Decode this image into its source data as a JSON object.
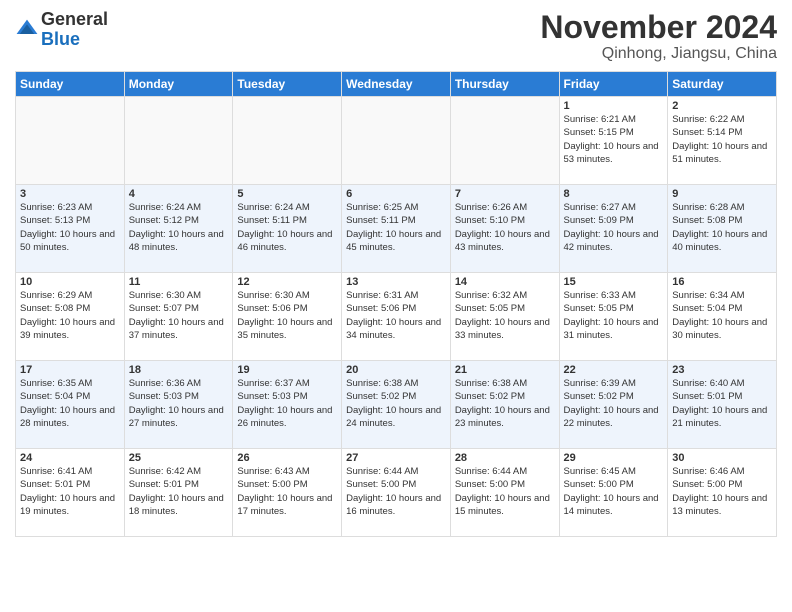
{
  "header": {
    "logo_general": "General",
    "logo_blue": "Blue",
    "month_title": "November 2024",
    "location": "Qinhong, Jiangsu, China"
  },
  "calendar": {
    "days_of_week": [
      "Sunday",
      "Monday",
      "Tuesday",
      "Wednesday",
      "Thursday",
      "Friday",
      "Saturday"
    ],
    "weeks": [
      [
        {
          "day": "",
          "info": ""
        },
        {
          "day": "",
          "info": ""
        },
        {
          "day": "",
          "info": ""
        },
        {
          "day": "",
          "info": ""
        },
        {
          "day": "",
          "info": ""
        },
        {
          "day": "1",
          "info": "Sunrise: 6:21 AM\nSunset: 5:15 PM\nDaylight: 10 hours and 53 minutes."
        },
        {
          "day": "2",
          "info": "Sunrise: 6:22 AM\nSunset: 5:14 PM\nDaylight: 10 hours and 51 minutes."
        }
      ],
      [
        {
          "day": "3",
          "info": "Sunrise: 6:23 AM\nSunset: 5:13 PM\nDaylight: 10 hours and 50 minutes."
        },
        {
          "day": "4",
          "info": "Sunrise: 6:24 AM\nSunset: 5:12 PM\nDaylight: 10 hours and 48 minutes."
        },
        {
          "day": "5",
          "info": "Sunrise: 6:24 AM\nSunset: 5:11 PM\nDaylight: 10 hours and 46 minutes."
        },
        {
          "day": "6",
          "info": "Sunrise: 6:25 AM\nSunset: 5:11 PM\nDaylight: 10 hours and 45 minutes."
        },
        {
          "day": "7",
          "info": "Sunrise: 6:26 AM\nSunset: 5:10 PM\nDaylight: 10 hours and 43 minutes."
        },
        {
          "day": "8",
          "info": "Sunrise: 6:27 AM\nSunset: 5:09 PM\nDaylight: 10 hours and 42 minutes."
        },
        {
          "day": "9",
          "info": "Sunrise: 6:28 AM\nSunset: 5:08 PM\nDaylight: 10 hours and 40 minutes."
        }
      ],
      [
        {
          "day": "10",
          "info": "Sunrise: 6:29 AM\nSunset: 5:08 PM\nDaylight: 10 hours and 39 minutes."
        },
        {
          "day": "11",
          "info": "Sunrise: 6:30 AM\nSunset: 5:07 PM\nDaylight: 10 hours and 37 minutes."
        },
        {
          "day": "12",
          "info": "Sunrise: 6:30 AM\nSunset: 5:06 PM\nDaylight: 10 hours and 35 minutes."
        },
        {
          "day": "13",
          "info": "Sunrise: 6:31 AM\nSunset: 5:06 PM\nDaylight: 10 hours and 34 minutes."
        },
        {
          "day": "14",
          "info": "Sunrise: 6:32 AM\nSunset: 5:05 PM\nDaylight: 10 hours and 33 minutes."
        },
        {
          "day": "15",
          "info": "Sunrise: 6:33 AM\nSunset: 5:05 PM\nDaylight: 10 hours and 31 minutes."
        },
        {
          "day": "16",
          "info": "Sunrise: 6:34 AM\nSunset: 5:04 PM\nDaylight: 10 hours and 30 minutes."
        }
      ],
      [
        {
          "day": "17",
          "info": "Sunrise: 6:35 AM\nSunset: 5:04 PM\nDaylight: 10 hours and 28 minutes."
        },
        {
          "day": "18",
          "info": "Sunrise: 6:36 AM\nSunset: 5:03 PM\nDaylight: 10 hours and 27 minutes."
        },
        {
          "day": "19",
          "info": "Sunrise: 6:37 AM\nSunset: 5:03 PM\nDaylight: 10 hours and 26 minutes."
        },
        {
          "day": "20",
          "info": "Sunrise: 6:38 AM\nSunset: 5:02 PM\nDaylight: 10 hours and 24 minutes."
        },
        {
          "day": "21",
          "info": "Sunrise: 6:38 AM\nSunset: 5:02 PM\nDaylight: 10 hours and 23 minutes."
        },
        {
          "day": "22",
          "info": "Sunrise: 6:39 AM\nSunset: 5:02 PM\nDaylight: 10 hours and 22 minutes."
        },
        {
          "day": "23",
          "info": "Sunrise: 6:40 AM\nSunset: 5:01 PM\nDaylight: 10 hours and 21 minutes."
        }
      ],
      [
        {
          "day": "24",
          "info": "Sunrise: 6:41 AM\nSunset: 5:01 PM\nDaylight: 10 hours and 19 minutes."
        },
        {
          "day": "25",
          "info": "Sunrise: 6:42 AM\nSunset: 5:01 PM\nDaylight: 10 hours and 18 minutes."
        },
        {
          "day": "26",
          "info": "Sunrise: 6:43 AM\nSunset: 5:00 PM\nDaylight: 10 hours and 17 minutes."
        },
        {
          "day": "27",
          "info": "Sunrise: 6:44 AM\nSunset: 5:00 PM\nDaylight: 10 hours and 16 minutes."
        },
        {
          "day": "28",
          "info": "Sunrise: 6:44 AM\nSunset: 5:00 PM\nDaylight: 10 hours and 15 minutes."
        },
        {
          "day": "29",
          "info": "Sunrise: 6:45 AM\nSunset: 5:00 PM\nDaylight: 10 hours and 14 minutes."
        },
        {
          "day": "30",
          "info": "Sunrise: 6:46 AM\nSunset: 5:00 PM\nDaylight: 10 hours and 13 minutes."
        }
      ]
    ]
  }
}
